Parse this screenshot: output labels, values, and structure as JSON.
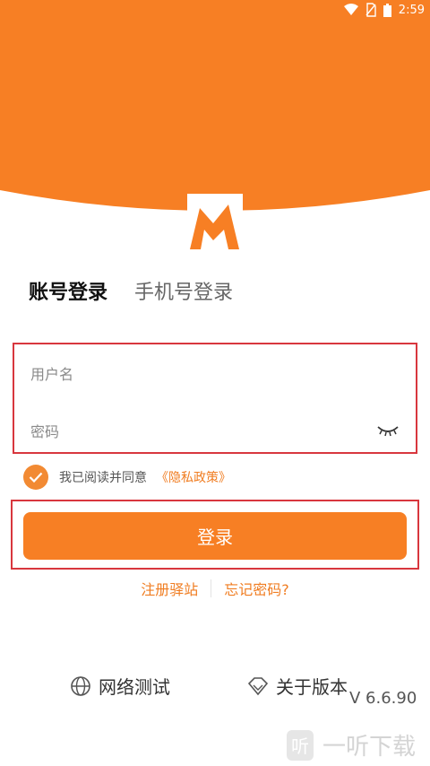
{
  "status_bar": {
    "time": "2:59"
  },
  "tabs": {
    "account_login": "账号登录",
    "phone_login": "手机号登录"
  },
  "form": {
    "username_placeholder": "用户名",
    "password_placeholder": "密码"
  },
  "agreement": {
    "text": "我已阅读并同意",
    "policy_link": "《隐私政策》",
    "checked": true
  },
  "login_button": {
    "label": "登录"
  },
  "links": {
    "register": "注册驿站",
    "forgot_password": "忘记密码?"
  },
  "bottom": {
    "network_test": "网络测试",
    "about_version": "关于版本",
    "version": "V 6.6.90"
  },
  "watermark": {
    "icon_text": "听",
    "text": "一听下载"
  },
  "colors": {
    "accent": "#f77f24",
    "highlight_border": "#d8373e"
  }
}
